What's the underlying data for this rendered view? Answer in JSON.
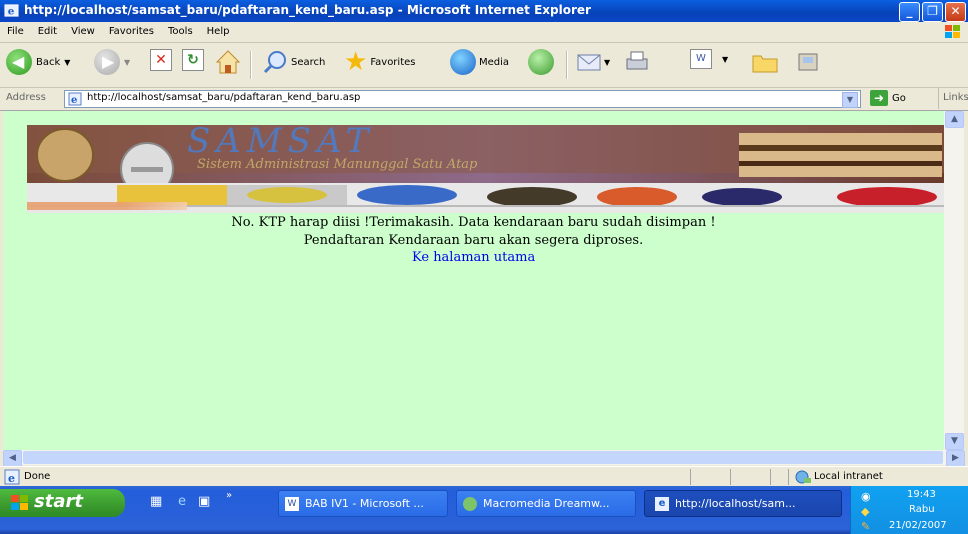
{
  "window": {
    "title": "http://localhost/samsat_baru/pdaftaran_kend_baru.asp - Microsoft Internet Explorer"
  },
  "menu": [
    "File",
    "Edit",
    "View",
    "Favorites",
    "Tools",
    "Help"
  ],
  "toolbar": {
    "back": "Back",
    "search": "Search",
    "favorites": "Favorites",
    "media": "Media"
  },
  "address": {
    "label": "Address",
    "url": "http://localhost/samsat_baru/pdaftaran_kend_baru.asp",
    "go": "Go",
    "links": "Links"
  },
  "page": {
    "banner_title": "SAMSAT",
    "banner_subtitle": "Sistem Administrasi Manunggal Satu Atap",
    "message_line1": "No. KTP harap diisi !Terimakasih. Data kendaraan baru sudah disimpan !",
    "message_line2": "Pendaftaran Kendaraan baru akan segera diproses.",
    "home_link": "Ke halaman utama"
  },
  "status": {
    "text": "Done",
    "zone": "Local intranet"
  },
  "taskbar": {
    "start": "start",
    "tasks": [
      "BAB IV1 - Microsoft ...",
      "Macromedia Dreamw...",
      "http://localhost/sam..."
    ],
    "clock": {
      "time": "19:43",
      "day": "Rabu",
      "date": "21/02/2007"
    }
  }
}
